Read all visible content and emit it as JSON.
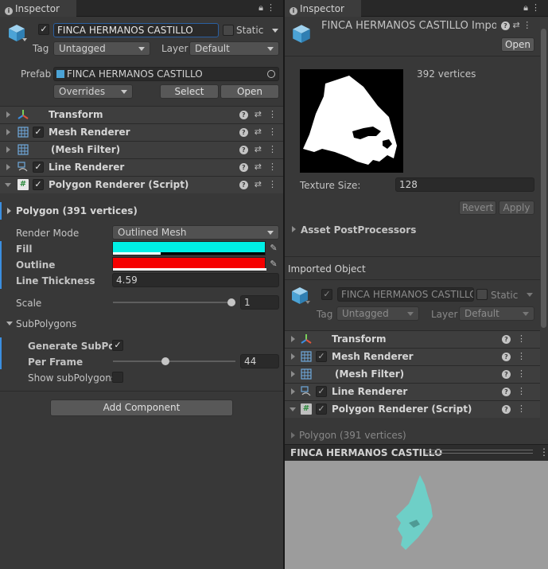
{
  "left": {
    "tab_label": "Inspector",
    "object_name": "FINCA HERMANOS CASTILLO",
    "static_label": "Static",
    "tag_label": "Tag",
    "tag_value": "Untagged",
    "layer_label": "Layer",
    "layer_value": "Default",
    "prefab_label": "Prefab",
    "prefab_value": "FINCA HERMANOS CASTILLO",
    "overrides_label": "Overrides",
    "select_label": "Select",
    "open_label": "Open",
    "components": [
      {
        "name": "Transform",
        "icon": "transform-icon"
      },
      {
        "name": "Mesh Renderer",
        "icon": "mesh-renderer-icon"
      },
      {
        "name": "(Mesh Filter)",
        "icon": "mesh-filter-icon"
      },
      {
        "name": "Line Renderer",
        "icon": "line-renderer-icon"
      },
      {
        "name": "Polygon Renderer (Script)",
        "icon": "script-icon"
      }
    ],
    "polygon_header": "Polygon (391 vertices)",
    "render_mode_label": "Render Mode",
    "render_mode_value": "Outlined Mesh",
    "fill_label": "Fill",
    "outline_label": "Outline",
    "line_thickness_label": "Line Thickness",
    "line_thickness_value": "4.59",
    "scale_label": "Scale",
    "scale_value": "1",
    "subpolygons_label": "SubPolygons",
    "generate_label": "Generate SubPoly",
    "per_frame_label": "Per Frame",
    "per_frame_value": "44",
    "show_label": "Show subPolygons",
    "add_component_label": "Add Component",
    "colors": {
      "fill": "#00f0e6",
      "outline": "#f50000",
      "accent": "#3b8ee0"
    }
  },
  "right": {
    "tab_label": "Inspector",
    "title": "FINCA HERMANOS CASTILLO Impo",
    "open_label": "Open",
    "vertices_text": "392 vertices",
    "texture_size_label": "Texture Size:",
    "texture_size_value": "128",
    "revert_label": "Revert",
    "apply_label": "Apply",
    "asset_postprocessors_label": "Asset PostProcessors",
    "imported_object_label": "Imported Object",
    "object_name": "FINCA HERMANOS CASTILLO",
    "static_label": "Static",
    "tag_label": "Tag",
    "tag_value": "Untagged",
    "layer_label": "Layer",
    "layer_value": "Default",
    "components": [
      {
        "name": "Transform"
      },
      {
        "name": "Mesh Renderer"
      },
      {
        "name": "(Mesh Filter)"
      },
      {
        "name": "Line Renderer"
      },
      {
        "name": "Polygon Renderer (Script)"
      }
    ],
    "polygon_header": "Polygon (391 vertices)",
    "preview_title": "FINCA HERMANOS CASTILLO",
    "colors": {
      "preview_bg": "#9c9c9c",
      "mesh": "#6ecfc7"
    }
  }
}
